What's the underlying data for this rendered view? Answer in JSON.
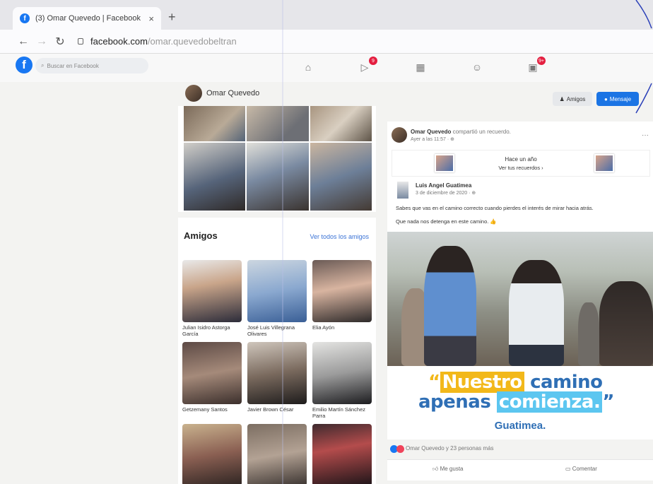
{
  "browser": {
    "tab_title": "(3) Omar Quevedo | Facebook",
    "tab_close": "×",
    "new_tab": "+",
    "url_domain": "facebook.com",
    "url_path": "/omar.quevedobeltran"
  },
  "fb_nav": {
    "logo": "f",
    "search_placeholder": "Buscar en Facebook",
    "watch_badge": "9",
    "notifications_badge": "9+"
  },
  "profile_bar": {
    "name": "Omar Quevedo",
    "friends_button": "Amigos",
    "message_button": "Mensaje"
  },
  "friends": {
    "title": "Amigos",
    "see_all": "Ver todos los amigos",
    "items": [
      {
        "name": "Julian Isidro Astorga García"
      },
      {
        "name": "José Luis Villegrana Olivares"
      },
      {
        "name": "Elia Ayón"
      },
      {
        "name": "Getzemany Santos"
      },
      {
        "name": "Javier Brown César"
      },
      {
        "name": "Emilio Martín Sánchez Parra"
      },
      {
        "name": ""
      },
      {
        "name": ""
      },
      {
        "name": ""
      }
    ]
  },
  "post": {
    "author": "Omar Quevedo",
    "action": "compartió un recuerdo.",
    "time": "Ayer a las 11:57 · ⊕",
    "more": "···",
    "memory_title": "Hace un año",
    "memory_link": "Ver tus recuerdos ›",
    "inner_author": "Luis Angel Guatimea",
    "inner_time": "3 de diciembre de 2020 · ⊕",
    "text_line1": "Sabes que vas en el camino correcto cuando pierdes el interés de mirar hacia atrás.",
    "text_line2": "Que nada nos detenga en este camino. 👍",
    "banner_line1_hl": "Nuestro",
    "banner_line1_rest": " camino",
    "banner_line2_pre": "apenas ",
    "banner_line2_hl": "comienza.",
    "banner_quote_open": "“",
    "banner_quote_close": "”",
    "banner_brand": "Guatimea.",
    "reactions_text": "Omar Quevedo y 23 personas más",
    "like": "Me gusta",
    "comment": "Comentar"
  },
  "colors": {
    "fb_blue": "#1877f2",
    "banner_blue": "#2f6fb5",
    "banner_yellow": "#f2b81a",
    "banner_cyan": "#5cc6f0"
  }
}
